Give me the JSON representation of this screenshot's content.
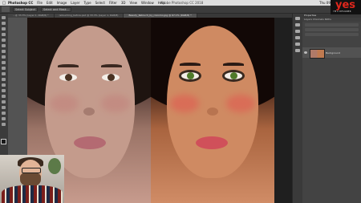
{
  "menubar": {
    "apple": "",
    "app_name": "Photoshop CC",
    "items": [
      "File",
      "Edit",
      "Image",
      "Layer",
      "Type",
      "Select",
      "Filter",
      "3D",
      "View",
      "Window",
      "Help"
    ],
    "window_title": "Adobe Photoshop CC 2018",
    "clock": "Thu 09:53"
  },
  "optionsbar": {
    "buttons": [
      "Select Subject",
      "Select and Mask..."
    ]
  },
  "tabs": [
    {
      "label": "...@ 33.3% (Layer 1, RGB/8) *",
      "active": false
    },
    {
      "label": "retouching_before.psd @ 33.3% (Layer 1, RGB/8)",
      "active": false
    },
    {
      "label": "Beauty_Retouch_by_roxiomo.jpg @ 67.1% (RGB/8) *",
      "active": true
    }
  ],
  "panel": {
    "title": "Properties",
    "tabs": "Layers  Channels  Paths",
    "layer_name": "Background"
  },
  "logo": {
    "text": "yes",
    "subtitle": "I'M A DESIGNER"
  },
  "colors": {
    "accent": "#e0271c",
    "toolbar": "#3b3b3b",
    "panel": "#434343"
  }
}
